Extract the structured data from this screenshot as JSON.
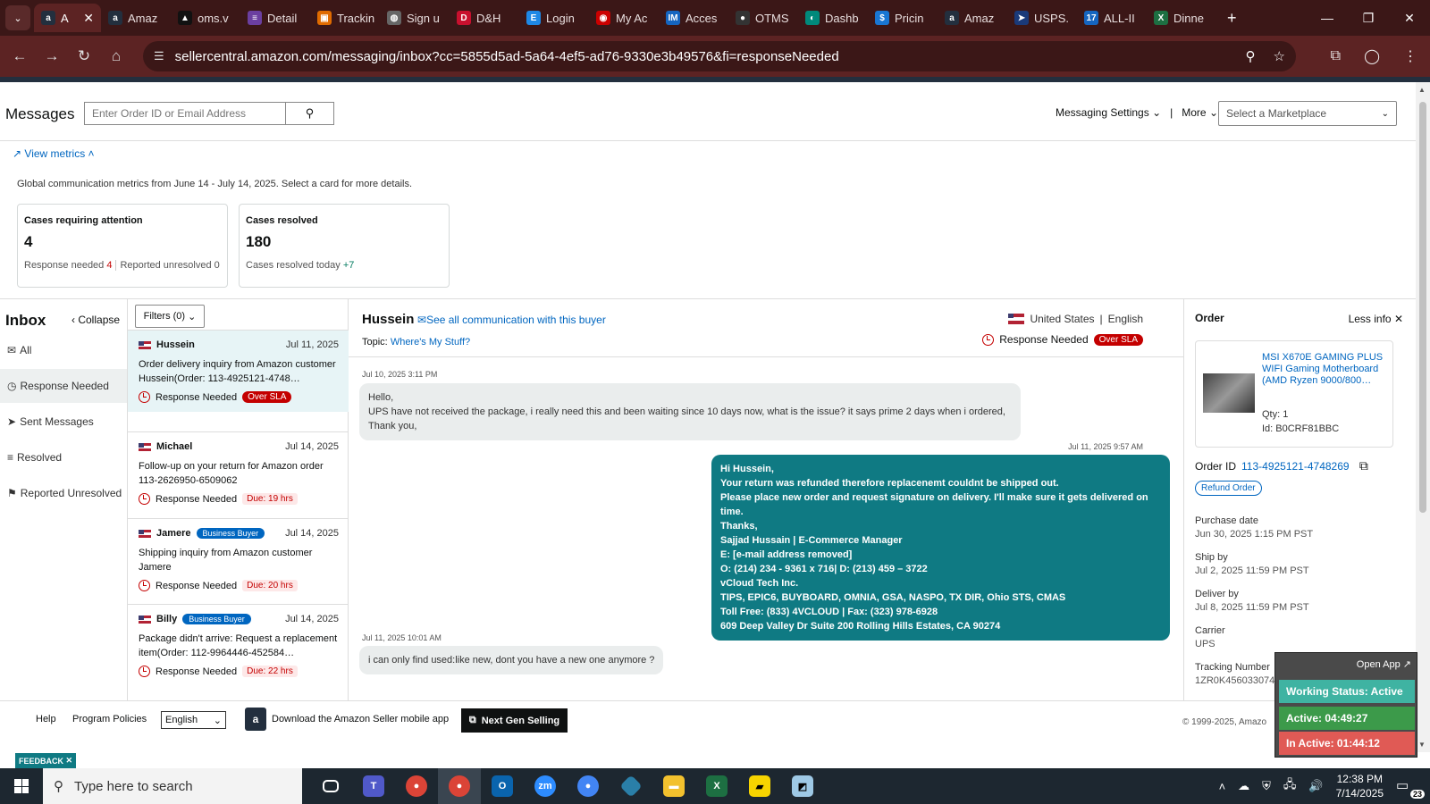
{
  "browser": {
    "tabs": [
      {
        "label": "A",
        "icon": "amazon-icon",
        "color": "#232f3e",
        "glyph": "a",
        "active": true
      },
      {
        "label": "Amaz",
        "icon": "amazon-icon",
        "color": "#232f3e",
        "glyph": "a"
      },
      {
        "label": "oms.v",
        "icon": "oms-icon",
        "color": "#111111",
        "glyph": "▲"
      },
      {
        "label": "Detail",
        "icon": "detail-icon",
        "color": "#6b3fa0",
        "glyph": "≡"
      },
      {
        "label": "Trackin",
        "icon": "tracking-icon",
        "color": "#e06b00",
        "glyph": "▣"
      },
      {
        "label": "Sign u",
        "icon": "globe-icon",
        "color": "#666666",
        "glyph": "◍"
      },
      {
        "label": "D&H",
        "icon": "dh-icon",
        "color": "#c8102e",
        "glyph": "D"
      },
      {
        "label": "Login",
        "icon": "ec-icon",
        "color": "#1e88e5",
        "glyph": "E"
      },
      {
        "label": "My Ac",
        "icon": "myaccount-icon",
        "color": "#cc0000",
        "glyph": "◉"
      },
      {
        "label": "Acces",
        "icon": "im-icon",
        "color": "#1565c0",
        "glyph": "IM"
      },
      {
        "label": "OTMS",
        "icon": "otms-icon",
        "color": "#333333",
        "glyph": "●"
      },
      {
        "label": "Dashb",
        "icon": "dashboard-icon",
        "color": "#00897b",
        "glyph": "◐"
      },
      {
        "label": "Pricin",
        "icon": "pricing-icon",
        "color": "#1976d2",
        "glyph": "$"
      },
      {
        "label": "Amaz",
        "icon": "amazon-icon",
        "color": "#232f3e",
        "glyph": "a"
      },
      {
        "label": "USPS.",
        "icon": "usps-icon",
        "color": "#1a3a7a",
        "glyph": "➤"
      },
      {
        "label": "ALL-II",
        "icon": "seventeen-icon",
        "color": "#1565c0",
        "glyph": "17"
      },
      {
        "label": "Dinne",
        "icon": "excel-icon",
        "color": "#1d6f42",
        "glyph": "X"
      }
    ],
    "url": "sellercentral.amazon.com/messaging/inbox?cc=5855d5ad-5a64-4ef5-ad76-9330e3b49576&fi=responseNeeded"
  },
  "header": {
    "title": "Messages",
    "search_placeholder": "Enter Order ID or Email Address",
    "messaging_settings": "Messaging Settings",
    "more": "More",
    "marketplace_placeholder": "Select a Marketplace"
  },
  "metrics": {
    "toggle_label": "View metrics",
    "description": "Global communication metrics from June 14 - July 14, 2025. Select a card for more details.",
    "attention": {
      "title": "Cases requiring attention",
      "value": "4",
      "response_needed_label": "Response needed",
      "response_needed_value": "4",
      "reported_label": "Reported unresolved",
      "reported_value": "0"
    },
    "resolved": {
      "title": "Cases resolved",
      "value": "180",
      "today_label": "Cases resolved today",
      "today_value": "+7"
    }
  },
  "inbox": {
    "title": "Inbox",
    "collapse": "Collapse",
    "nav": [
      "All",
      "Response Needed",
      "Sent Messages",
      "Resolved",
      "Reported Unresolved"
    ],
    "filters": "Filters (0)",
    "items": [
      {
        "name": "Hussein",
        "date": "Jul 11, 2025",
        "text": "Order delivery inquiry from Amazon customer Hussein(Order: 113-4925121-4748…",
        "status": "Response Needed",
        "badge": "Over SLA",
        "business": ""
      },
      {
        "name": "Michael",
        "date": "Jul 14, 2025",
        "text": "Follow-up on your return for Amazon order 113-2626950-6509062",
        "status": "Response Needed",
        "badge": "Due: 19 hrs",
        "business": ""
      },
      {
        "name": "Jamere",
        "date": "Jul 14, 2025",
        "text": "Shipping inquiry from Amazon customer Jamere",
        "status": "Response Needed",
        "badge": "Due: 20 hrs",
        "business": "Business Buyer"
      },
      {
        "name": "Billy",
        "date": "Jul 14, 2025",
        "text": "Package didn't arrive: Request a replacement item(Order: 112-9964446-452584…",
        "status": "Response Needed",
        "badge": "Due: 22 hrs",
        "business": "Business Buyer"
      }
    ]
  },
  "conversation": {
    "buyer": "Hussein",
    "see_all": "See all communication with this buyer",
    "topic_label": "Topic:",
    "topic": "Where's My Stuff?",
    "country": "United States",
    "language": "English",
    "status": "Response Needed",
    "sla": "Over SLA",
    "messages": [
      {
        "time": "Jul 10, 2025 3:11 PM",
        "lines": [
          "Hello,",
          "UPS have not received the package, i really need this and been waiting since 10 days now, what is the issue? it says prime 2 days when i ordered,",
          "Thank you,"
        ]
      },
      {
        "time": "Jul 11, 2025 9:57 AM",
        "lines": [
          "Hi Hussein,",
          "Your return was refunded therefore replacenemt couldnt be shipped out.",
          "Please place new order and request signature on delivery. I'll make sure it gets delivered on time.",
          "Thanks,",
          "Sajjad Hussain | E-Commerce Manager",
          "E: [e-mail address removed]",
          "O: (214) 234 - 9361 x 716| D: (213) 459 – 3722",
          "vCloud Tech Inc.",
          "TIPS, EPIC6, BUYBOARD, OMNIA, GSA, NASPO, TX DIR, Ohio STS, CMAS",
          "Toll Free: (833) 4VCLOUD | Fax: (323) 978-6928",
          "609 Deep Valley Dr Suite 200 Rolling Hills Estates, CA 90274"
        ]
      },
      {
        "time": "Jul 11, 2025 10:01 AM",
        "lines": [
          "i can only find used:like new, dont you have a new one anymore ?"
        ]
      }
    ]
  },
  "order": {
    "title": "Order",
    "less_info": "Less info",
    "product_name": "MSI X670E GAMING PLUS WIFI Gaming Motherboard (AMD Ryzen 9000/800…",
    "qty": "Qty: 1",
    "id": "Id: B0CRF81BBC",
    "order_id_label": "Order ID",
    "order_id": "113-4925121-4748269",
    "refund": "Refund Order",
    "purchase_date_label": "Purchase date",
    "purchase_date": "Jun 30, 2025 1:15 PM PST",
    "ship_by_label": "Ship by",
    "ship_by": "Jul 2, 2025 11:59 PM PST",
    "deliver_by_label": "Deliver by",
    "deliver_by": "Jul 8, 2025 11:59 PM PST",
    "carrier_label": "Carrier",
    "carrier": "UPS",
    "tracking_label": "Tracking Number",
    "tracking": "1ZR0K4560330748619"
  },
  "footer": {
    "help": "Help",
    "policies": "Program Policies",
    "language": "English",
    "app": "Download the Amazon Seller mobile app",
    "next_gen": "Next Gen Selling",
    "copyright": "© 1999-2025, Amazo",
    "feedback": "FEEDBACK"
  },
  "widget": {
    "open_app": "Open App ↗",
    "status": "Working Status: Active",
    "active": "Active: 04:49:27",
    "inactive": "In Active: 01:44:12",
    "colors": {
      "status": "#3fb3a2",
      "active": "#3c9a4a",
      "inactive": "#e05a55"
    }
  },
  "taskbar": {
    "search": "Type here to search",
    "time": "12:38 PM",
    "date": "7/14/2025",
    "notifications": "23"
  }
}
